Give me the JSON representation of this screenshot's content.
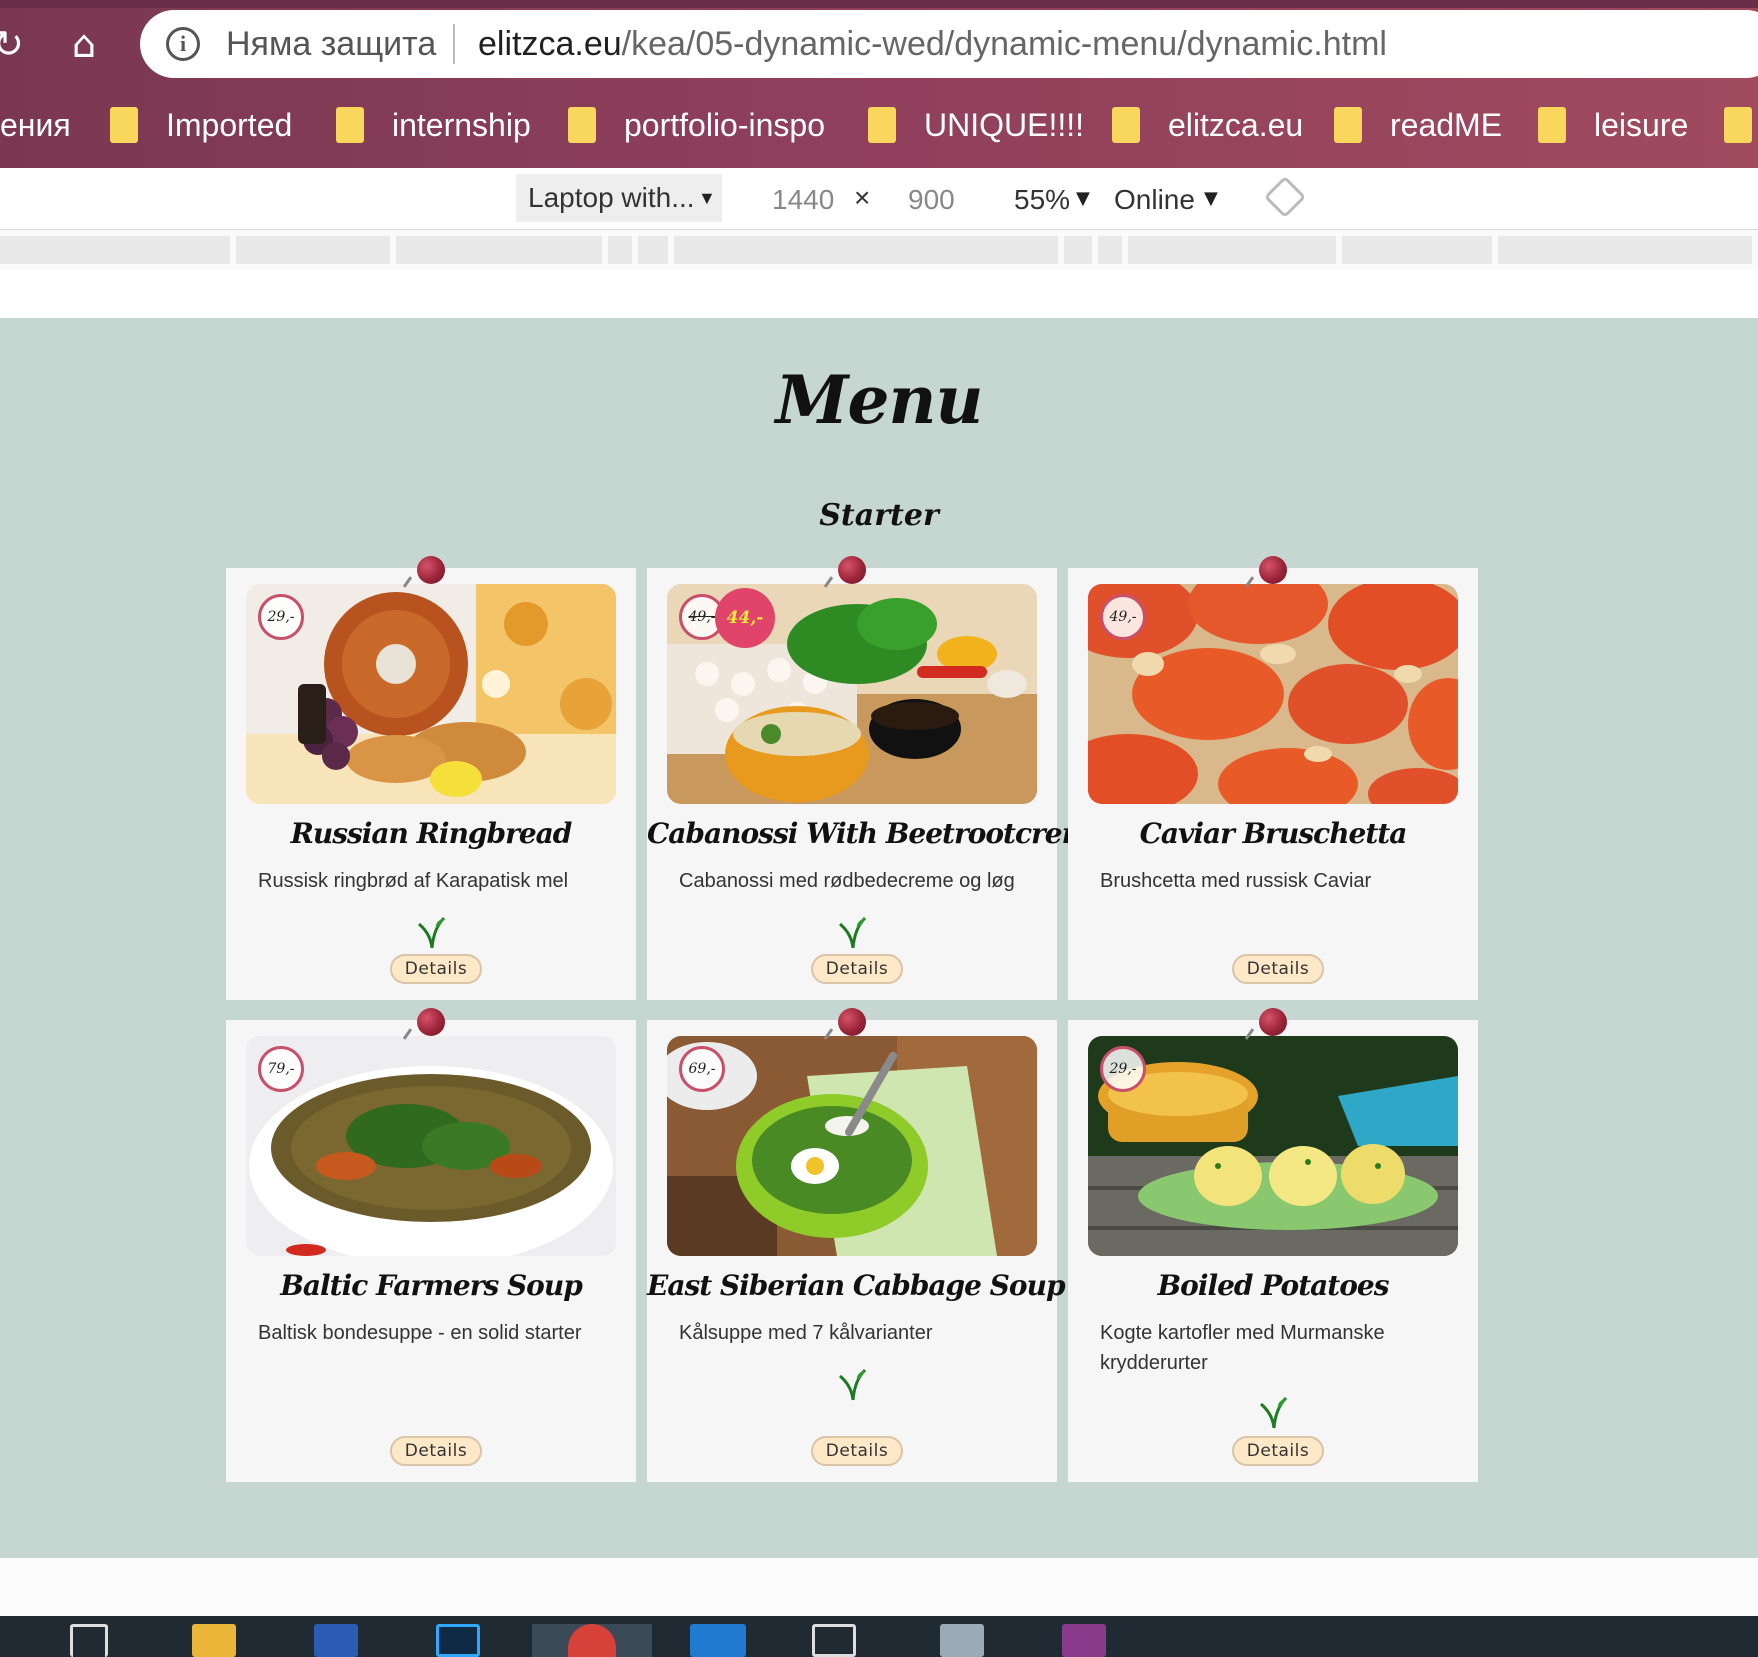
{
  "browser": {
    "security_text": "Няма защита",
    "url_host": "elitzca.eu",
    "url_path": "/kea/05-dynamic-wed/dynamic-menu/dynamic.html",
    "bookmarks": [
      "ения",
      "Imported",
      "internship",
      "portfolio-inspo",
      "UNIQUE!!!!",
      "elitzca.eu",
      "readME",
      "leisure"
    ]
  },
  "device_toolbar": {
    "device": "Laptop with...",
    "width": "1440",
    "times": "×",
    "height": "900",
    "zoom": "55%",
    "network": "Online"
  },
  "page": {
    "title": "Menu",
    "section": "Starter",
    "details_label": "Details",
    "dishes": [
      {
        "name": "Russian Ringbread",
        "desc": "Russisk ringbrød af Karapatisk mel",
        "price": "29,-",
        "vegetarian": true
      },
      {
        "name": "Cabanossi With Beetrootcreme",
        "desc": "Cabanossi med rødbedecreme og løg",
        "price": "49,-",
        "discount_price": "44,-",
        "vegetarian": true
      },
      {
        "name": "Caviar Bruschetta",
        "desc": "Brushcetta med russisk Caviar",
        "price": "49,-",
        "vegetarian": false
      },
      {
        "name": "Baltic Farmers Soup",
        "desc": "Baltisk bondesuppe - en solid starter",
        "price": "79,-",
        "vegetarian": false
      },
      {
        "name": "East Siberian Cabbage Soup",
        "desc": "Kålsuppe med 7 kålvarianter",
        "price": "69,-",
        "vegetarian": true
      },
      {
        "name": "Boiled Potatoes",
        "desc": "Kogte kartofler med Murmanske krydderurter",
        "price": "29,-",
        "vegetarian": true
      }
    ]
  },
  "colors": {
    "page_bg": "#c6d6d0",
    "card_bg": "#f6f6f6",
    "price_ring": "#c8506a",
    "discount_bg": "#e0446a",
    "details_bg": "#fde8c8",
    "chrome": "#8e3f5c"
  },
  "icons": [
    "reload-icon",
    "home-icon",
    "info-icon",
    "folder-icon",
    "rotate-icon",
    "pin-icon",
    "vegetarian-sprout-icon"
  ]
}
